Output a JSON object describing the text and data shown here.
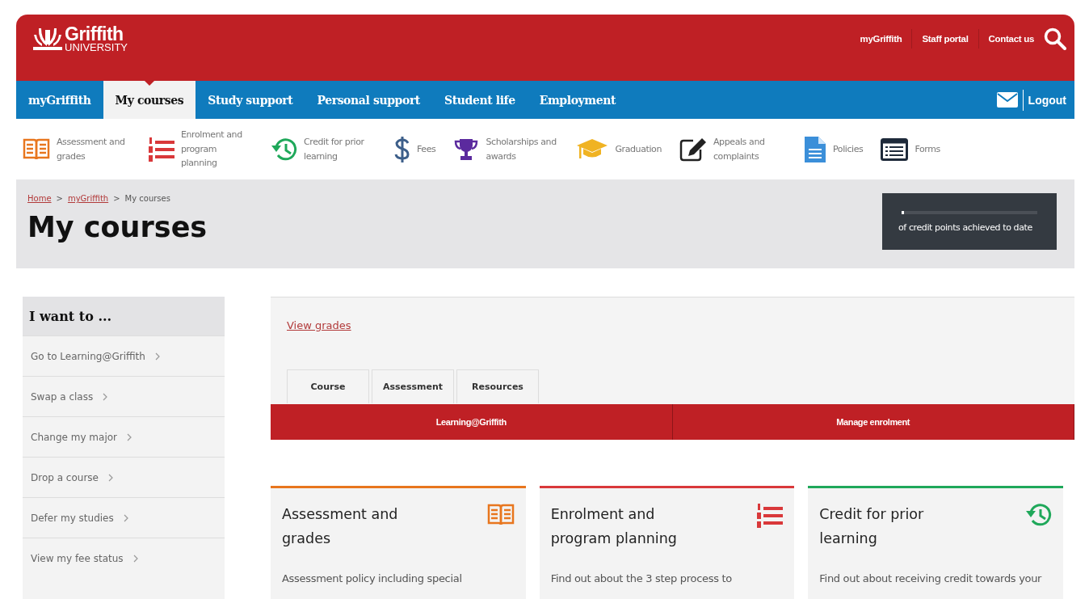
{
  "header": {
    "logo": {
      "name": "Griffith",
      "sub": "UNIVERSITY"
    },
    "links": [
      "myGriffith",
      "Staff portal",
      "Contact us"
    ]
  },
  "nav": {
    "items": [
      {
        "label": "myGriffith",
        "selected": false
      },
      {
        "label": "My courses",
        "selected": true
      },
      {
        "label": "Study support",
        "selected": false
      },
      {
        "label": "Personal support",
        "selected": false
      },
      {
        "label": "Student life",
        "selected": false
      },
      {
        "label": "Employment",
        "selected": false
      }
    ],
    "logout": "Logout"
  },
  "quick_links": [
    {
      "kind": "book",
      "label": "Assessment and grades",
      "color": "#e8761e"
    },
    {
      "kind": "list",
      "label": "Enrolment and program planning",
      "color": "#d9383a"
    },
    {
      "kind": "history",
      "label": "Credit for prior learning",
      "color": "#1fa85a"
    },
    {
      "kind": "dollar",
      "label": "Fees",
      "color": "#3d5f8a"
    },
    {
      "kind": "trophy",
      "label": "Scholarships and awards",
      "color": "#5b2a9e"
    },
    {
      "kind": "cap",
      "label": "Graduation",
      "color": "#f0b323"
    },
    {
      "kind": "edit",
      "label": "Appeals and complaints",
      "color": "#222222"
    },
    {
      "kind": "doc",
      "label": "Policies",
      "color": "#3b8fd9"
    },
    {
      "kind": "forms",
      "label": "Forms",
      "color": "#1e2a3a"
    }
  ],
  "breadcrumb": [
    {
      "kind": "link",
      "label": "Home"
    },
    {
      "kind": "separator",
      "label": ">"
    },
    {
      "kind": "link",
      "label": "myGriffith"
    },
    {
      "kind": "separator",
      "label": ">"
    },
    {
      "kind": "current",
      "label": "My courses"
    }
  ],
  "page_title": "My courses",
  "credit_points": {
    "level": 0.01,
    "caption": "of credit points achieved to date"
  },
  "sidebar": {
    "title": "I want to ...",
    "items": [
      "Go to Learning@Griffith",
      "Swap a class",
      "Change my major",
      "Drop a course",
      "Defer my studies",
      "View my fee status"
    ]
  },
  "main": {
    "view_grades": "View grades",
    "tabs": [
      "Course",
      "Assessment",
      "Resources"
    ],
    "actions": [
      "Learning@Griffith",
      "Manage enrolment"
    ]
  },
  "cards": [
    {
      "kind": "book",
      "title": "Assessment and grades",
      "text": "Assessment policy including special",
      "color": "#e8761e"
    },
    {
      "kind": "list",
      "title": "Enrolment and program planning",
      "text": "Find out about the 3 step process to",
      "color": "#d9383a"
    },
    {
      "kind": "history",
      "title": "Credit for prior learning",
      "text": "Find out about receiving credit towards your",
      "color": "#1fa85a"
    }
  ]
}
